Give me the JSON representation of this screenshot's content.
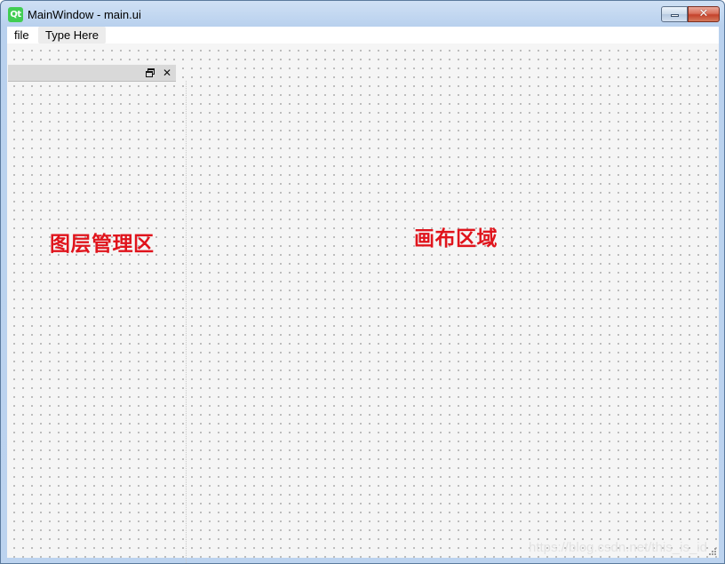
{
  "window": {
    "title": "MainWindow - main.ui",
    "app_icon_text": "Qt",
    "close_glyph": "✕"
  },
  "menubar": {
    "items": [
      {
        "label": "file"
      },
      {
        "label": "Type Here"
      }
    ]
  },
  "dock": {
    "close_glyph": "✕"
  },
  "annotations": {
    "layer_area": "图层管理区",
    "canvas_area": "画布区域"
  },
  "watermark": "https://blog.csdn.net/this_is_id",
  "colors": {
    "annotation": "#e0141c",
    "qt_icon": "#41cd52"
  },
  "icons": {
    "minimize": "minimize-icon",
    "close": "close-icon",
    "dock_float": "float-window-icon",
    "dock_close": "close-icon",
    "resize": "resize-grip-icon"
  }
}
